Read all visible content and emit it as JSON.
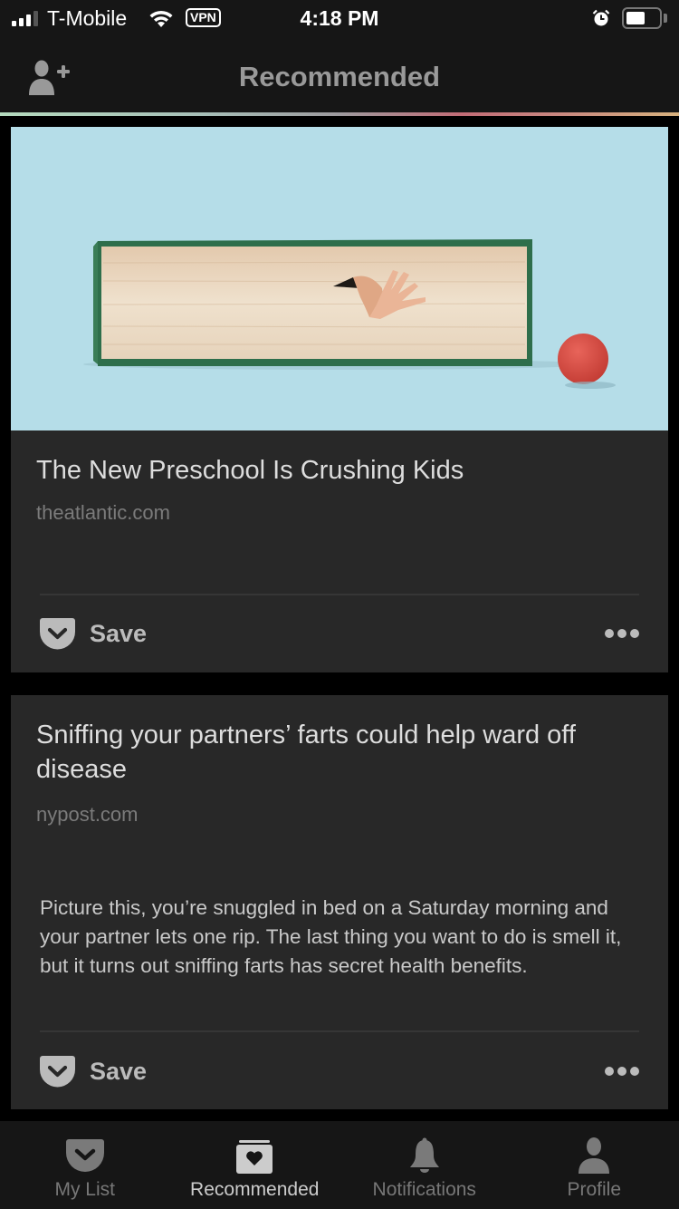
{
  "status_bar": {
    "carrier": "T-Mobile",
    "vpn_label": "VPN",
    "time": "4:18 PM",
    "signal_bars": 3,
    "signal_bars_max": 4,
    "battery_percent": 55,
    "icons": [
      "signal-icon",
      "wifi-icon",
      "vpn-badge",
      "alarm-icon",
      "battery-icon"
    ]
  },
  "header": {
    "title": "Recommended",
    "left_icon": "add-friend-icon"
  },
  "colors": {
    "background": "#000000",
    "bar_background": "#161616",
    "card_background": "#282828",
    "accent_gradient": [
      "#b5dbbe",
      "#a7bfb8",
      "#9d9a9e",
      "#c26c76",
      "#c98780",
      "#d8b27e"
    ]
  },
  "feed": [
    {
      "title": "The New Preschool Is Crushing Kids",
      "domain": "theatlantic.com",
      "has_image": true,
      "image_description": "Large green hardcover book lying on its side with a hand reaching out from between the pages, red ball nearby, light blue background",
      "excerpt": "",
      "save_label": "Save",
      "more_icon": "more-dots-icon"
    },
    {
      "title": "Sniffing your partners’ farts could help ward off disease",
      "domain": "nypost.com",
      "has_image": false,
      "excerpt": "Picture this, you’re snuggled in bed on a Saturday morning and your partner lets one rip. The last thing you want to do is smell it, but it turns out sniffing farts has secret health benefits.",
      "save_label": "Save",
      "more_icon": "more-dots-icon"
    }
  ],
  "tab_bar": {
    "active": 1,
    "tabs": [
      {
        "label": "My List",
        "icon": "pocket-icon"
      },
      {
        "label": "Recommended",
        "icon": "heart-box-icon"
      },
      {
        "label": "Notifications",
        "icon": "bell-icon"
      },
      {
        "label": "Profile",
        "icon": "person-icon"
      }
    ]
  }
}
